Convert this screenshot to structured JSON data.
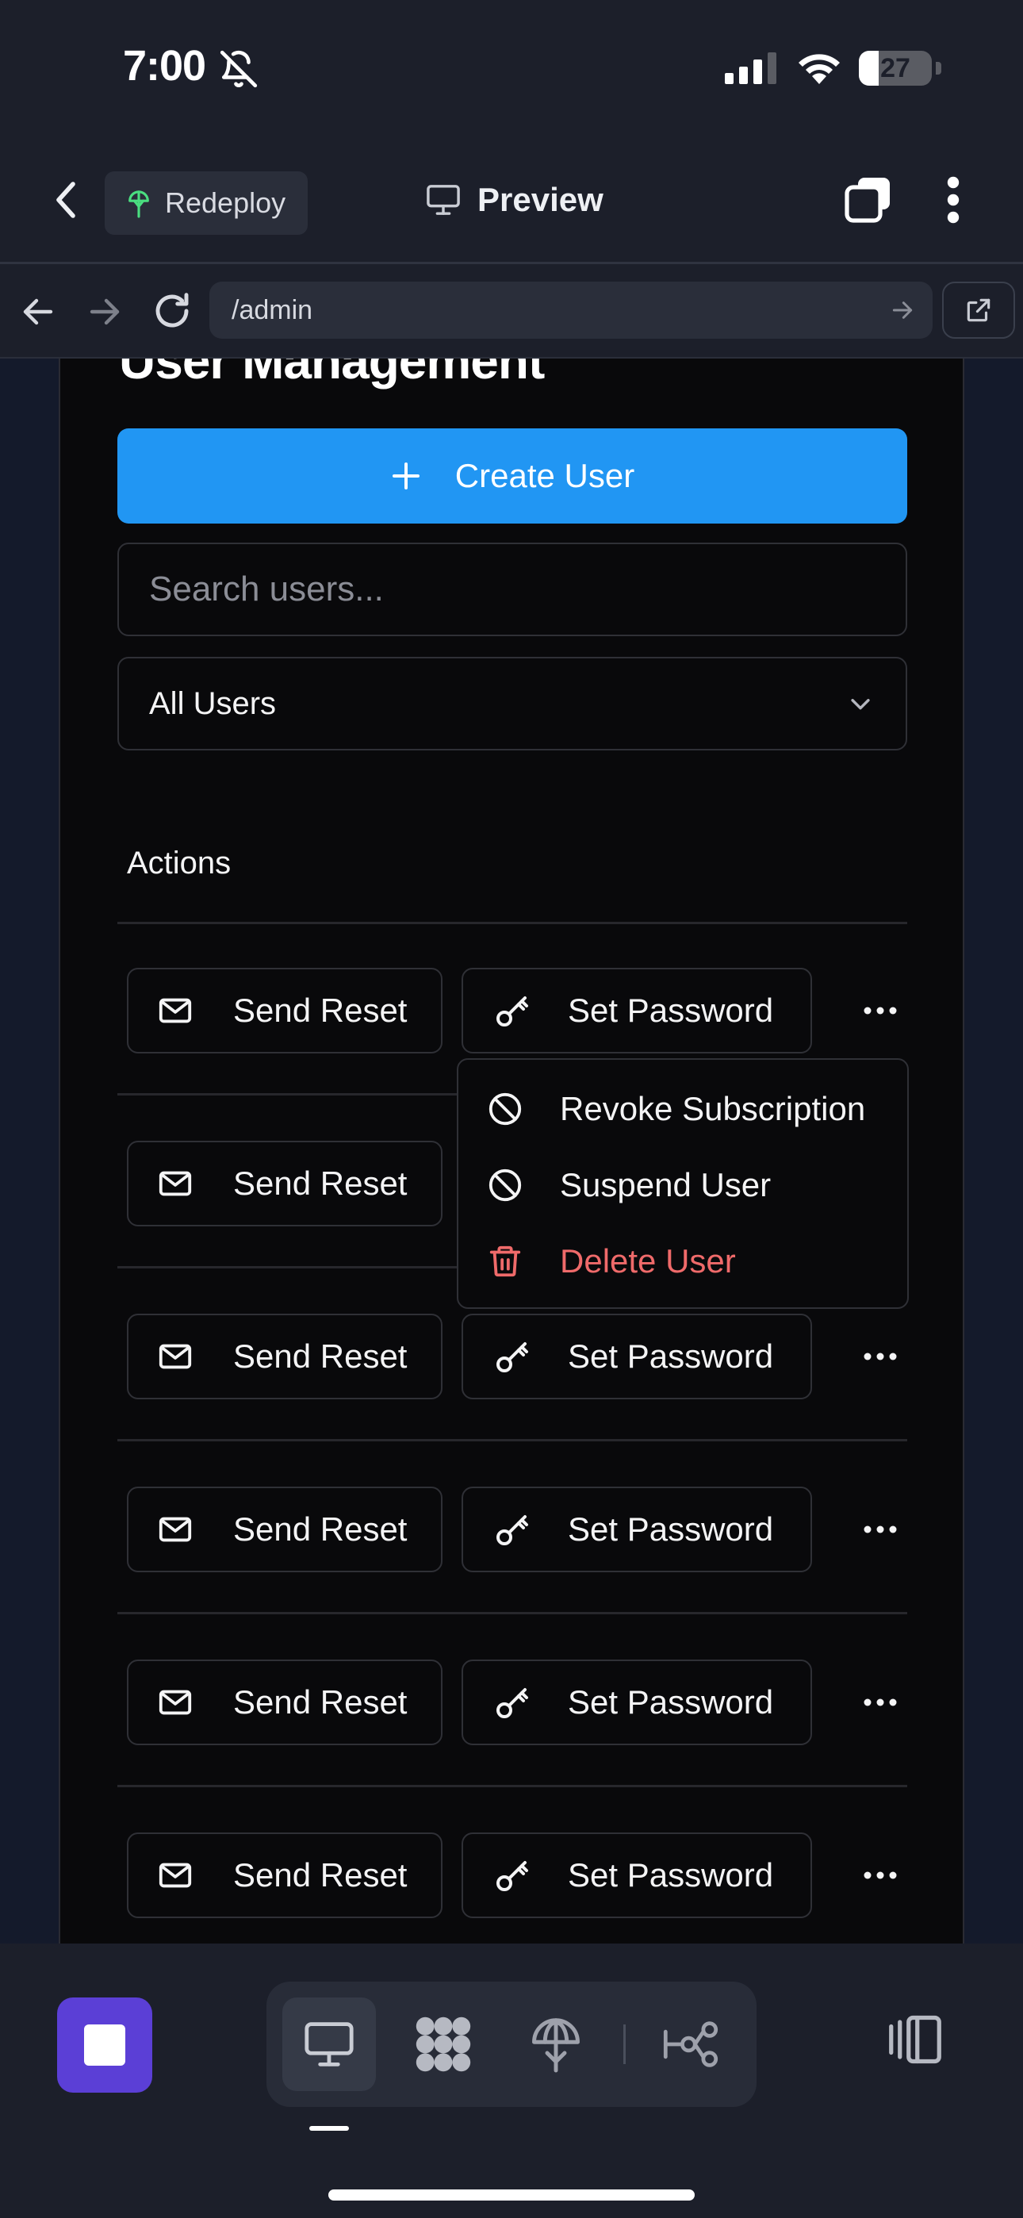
{
  "status_bar": {
    "time": "7:00",
    "battery": "27",
    "battery_level": 0.27,
    "icons": [
      "bell-slash-icon",
      "signal-icon",
      "wifi-icon",
      "battery-icon"
    ]
  },
  "header": {
    "redeploy_label": "Redeploy",
    "preview_label": "Preview",
    "icons": [
      "chevron-left-icon",
      "redeploy-icon",
      "monitor-icon",
      "tabs-icon",
      "more-vertical-icon"
    ]
  },
  "browser": {
    "url": "/admin",
    "icons": [
      "arrow-left-icon",
      "arrow-right-icon",
      "reload-icon",
      "arrow-right-small-icon",
      "external-link-icon"
    ]
  },
  "page": {
    "title": "User Management",
    "create_button": "Create User",
    "search_placeholder": "Search users...",
    "filter_value": "All Users",
    "actions_header": "Actions",
    "colors": {
      "primary": "#2196f3",
      "danger": "#ef6a6a",
      "background": "#09090b"
    }
  },
  "rows": [
    {
      "reset_label": "Send Reset",
      "password_label": "Set Password"
    },
    {
      "reset_label": "Send Reset",
      "password_label": ""
    },
    {
      "reset_label": "Send Reset",
      "password_label": "Set Password"
    },
    {
      "reset_label": "Send Reset",
      "password_label": "Set Password"
    },
    {
      "reset_label": "Send Reset",
      "password_label": "Set Password"
    },
    {
      "reset_label": "Send Reset",
      "password_label": "Set Password"
    }
  ],
  "dropdown": {
    "items": [
      {
        "label": "Revoke Subscription",
        "icon": "ban-icon"
      },
      {
        "label": "Suspend User",
        "icon": "ban-icon"
      },
      {
        "label": "Delete User",
        "icon": "trash-icon"
      }
    ]
  },
  "toolbar": {
    "stop_color": "#5b3fd6",
    "tools": [
      "monitor-icon",
      "grid-blob-icon",
      "deploy-icon",
      "workflow-icon",
      "panels-icon"
    ]
  }
}
